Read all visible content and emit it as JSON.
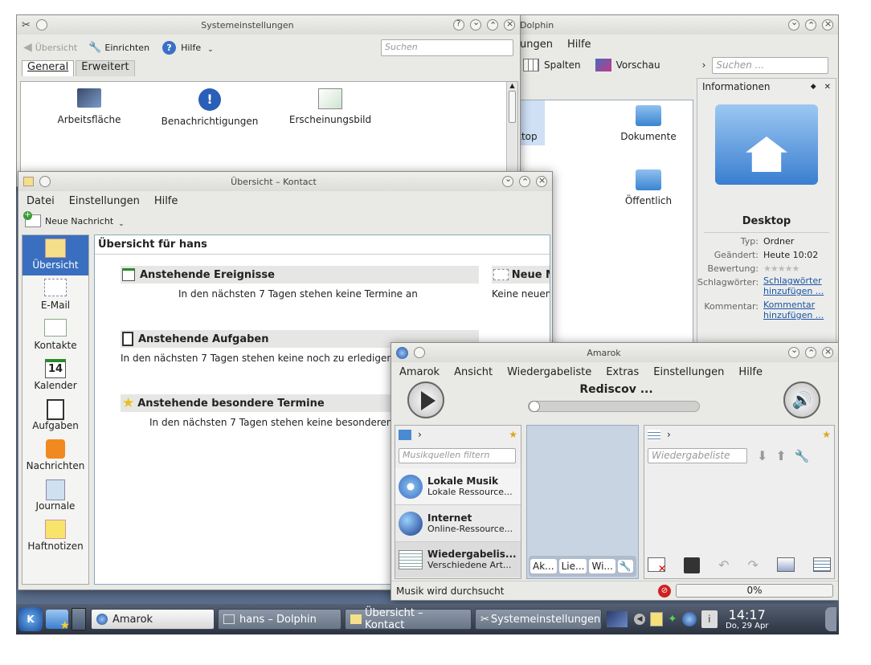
{
  "systemsettings": {
    "title": "Systemeinstellungen",
    "back": "Übersicht",
    "configure": "Einrichten",
    "help": "Hilfe",
    "search_placeholder": "Suchen",
    "tabs": [
      "General",
      "Erweitert"
    ],
    "items": [
      "Arbeitsfläche",
      "Benachrichtigungen",
      "Erscheinungsbild"
    ]
  },
  "dolphin": {
    "title": "Dolphin",
    "menu": [
      "ungen",
      "Hilfe"
    ],
    "toolbar": [
      "Spalten",
      "Vorschau"
    ],
    "search_placeholder": "Suchen ...",
    "files": [
      "ktop",
      "Dokumente",
      "Öffentlich"
    ],
    "info": {
      "header": "Informationen",
      "name": "Desktop",
      "type_label": "Typ:",
      "type": "Ordner",
      "changed_label": "Geändert:",
      "changed": "Heute 10:02",
      "rating_label": "Bewertung:",
      "tags_label": "Schlagwörter:",
      "tags_link": "Schlagwörter hinzufügen ...",
      "comment_label": "Kommentar:",
      "comment_link": "Kommentar hinzufügen ..."
    }
  },
  "kontact": {
    "title": "Übersicht – Kontact",
    "menu": [
      "Datei",
      "Einstellungen",
      "Hilfe"
    ],
    "new_message": "Neue Nachricht",
    "sidebar": [
      "Übersicht",
      "E-Mail",
      "Kontakte",
      "Kalender",
      "Aufgaben",
      "Nachrichten",
      "Journale",
      "Haftnotizen"
    ],
    "calendar_day": "14",
    "heading": "Übersicht für hans",
    "sections": [
      {
        "title": "Anstehende Ereignisse",
        "text": "In den nächsten 7 Tagen stehen keine Termine an"
      },
      {
        "title": "Anstehende Aufgaben",
        "text": "In den nächsten 7 Tagen stehen keine noch zu erledigen"
      },
      {
        "title": "Anstehende besondere Termine",
        "text": "In den nächsten 7 Tagen stehen keine besonderen"
      }
    ],
    "mail_title": "Neue M",
    "mail_text": "Keine neuen"
  },
  "amarok": {
    "title": "Amarok",
    "menu": [
      "Amarok",
      "Ansicht",
      "Wiedergabeliste",
      "Extras",
      "Einstellungen",
      "Hilfe"
    ],
    "track": "Rediscov ...",
    "filter_placeholder": "Musikquellen filtern",
    "sources": [
      {
        "title": "Lokale Musik",
        "sub": "Lokale Ressource..."
      },
      {
        "title": "Internet",
        "sub": "Online-Ressource..."
      },
      {
        "title": "Wiedergabelis...",
        "sub": "Verschiedene Art..."
      }
    ],
    "context_tabs": [
      "Ak...",
      "Lie...",
      "Wi..."
    ],
    "playlist_placeholder": "Wiedergabeliste",
    "status": "Musik wird durchsucht",
    "progress_percent": 0,
    "progress_text": "0%"
  },
  "taskbar": {
    "tasks": [
      "Amarok",
      "hans – Dolphin",
      "Übersicht – Kontact",
      "Systemeinstellungen"
    ],
    "time": "14:17",
    "date": "Do, 29 Apr",
    "info_glyph": "i"
  }
}
